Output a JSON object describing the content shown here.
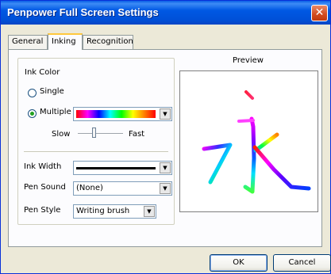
{
  "window": {
    "title": "Penpower Full Screen Settings",
    "close_symbol": "✕"
  },
  "tabs": [
    {
      "label": "General",
      "active": false
    },
    {
      "label": "Inking",
      "active": true
    },
    {
      "label": "Recognition",
      "active": false
    }
  ],
  "ink_color": {
    "group_label": "Ink Color",
    "options": [
      {
        "label": "Single",
        "checked": false
      },
      {
        "label": "Multiple",
        "checked": true
      }
    ],
    "speed_min_label": "Slow",
    "speed_max_label": "Fast",
    "speed_value": 0.35
  },
  "ink_width": {
    "label": "Ink Width"
  },
  "pen_sound": {
    "label": "Pen Sound",
    "value": "(None)"
  },
  "pen_style": {
    "label": "Pen Style",
    "value": "Writing brush"
  },
  "preview": {
    "label": "Preview",
    "character": "永"
  },
  "buttons": {
    "ok": "OK",
    "cancel": "Cancel"
  },
  "icons": {
    "close": "close-icon",
    "dropdown": "chevron-down-icon"
  },
  "colors": {
    "title_bar": "#0058e4",
    "close_button": "#d24a1e",
    "tab_highlight": "#ffc83c",
    "radio_dot": "#21a121"
  }
}
